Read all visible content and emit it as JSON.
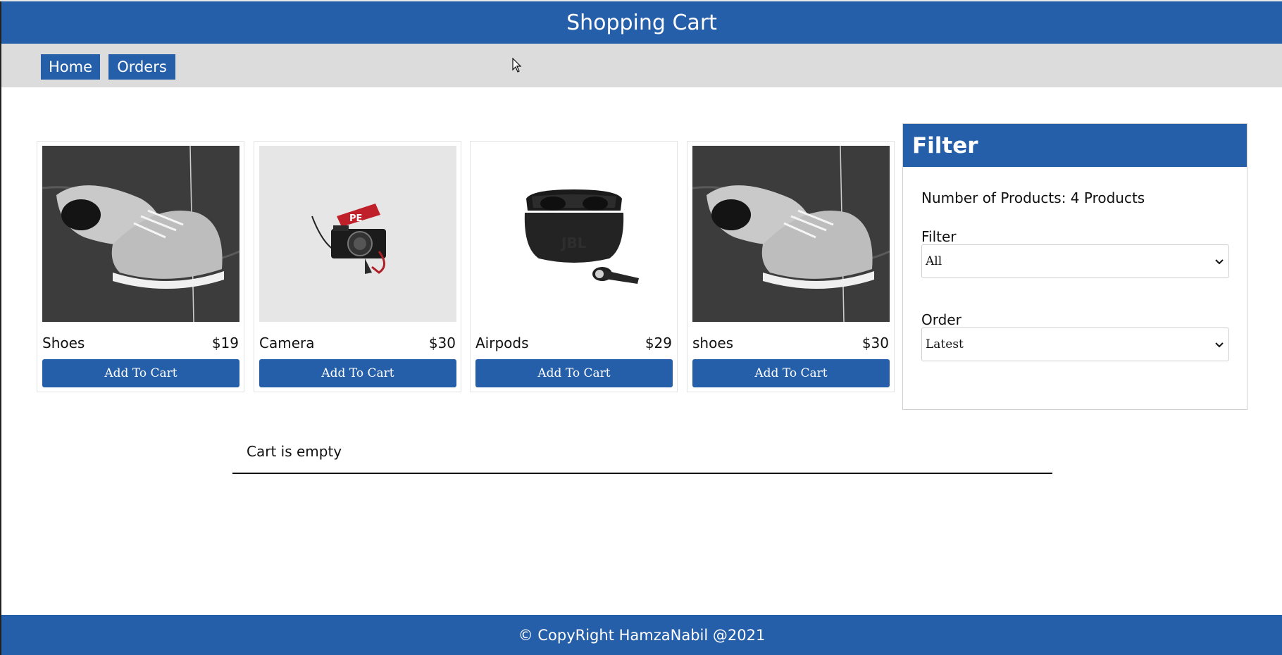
{
  "header": {
    "title": "Shopping Cart"
  },
  "nav": {
    "home_label": "Home",
    "orders_label": "Orders"
  },
  "products": [
    {
      "name": "Shoes",
      "price": "$19",
      "button": "Add To Cart",
      "image": "sneakers-photo"
    },
    {
      "name": "Camera",
      "price": "$30",
      "button": "Add To Cart",
      "image": "camera-photo"
    },
    {
      "name": "Airpods",
      "price": "$29",
      "button": "Add To Cart",
      "image": "earbuds-photo"
    },
    {
      "name": "shoes",
      "price": "$30",
      "button": "Add To Cart",
      "image": "sneakers-photo"
    }
  ],
  "filter_panel": {
    "title": "Filter",
    "count_text": "Number of Products: 4 Products",
    "filter_label": "Filter",
    "filter_value": "All",
    "order_label": "Order",
    "order_value": "Latest"
  },
  "cart": {
    "empty_text": "Cart is empty"
  },
  "footer": {
    "text": "© CopyRight HamzaNabil @2021"
  },
  "colors": {
    "primary": "#255ea9",
    "navbar_bg": "#dcdcdc"
  }
}
